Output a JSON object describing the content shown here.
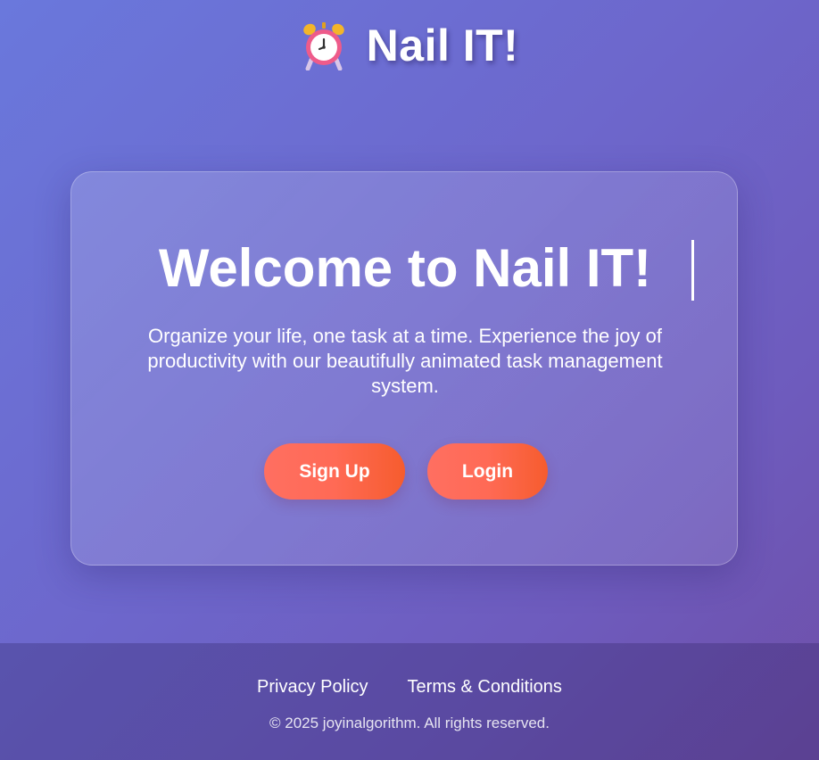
{
  "header": {
    "icon": "alarm-clock-icon",
    "title": "Nail IT!"
  },
  "hero": {
    "title": "Welcome to Nail IT!",
    "tagline": "Organize your life, one task at a time. Experience the joy of productivity with our beautifully animated task management system.",
    "signup_label": "Sign Up",
    "login_label": "Login"
  },
  "footer": {
    "privacy_label": "Privacy Policy",
    "terms_label": "Terms & Conditions",
    "copyright": "© 2025 joyinalgorithm. All rights reserved."
  },
  "colors": {
    "background_start": "#6a78dc",
    "background_end": "#6f4fa8",
    "button_start": "#ff6f61",
    "button_end": "#f65c2e"
  }
}
